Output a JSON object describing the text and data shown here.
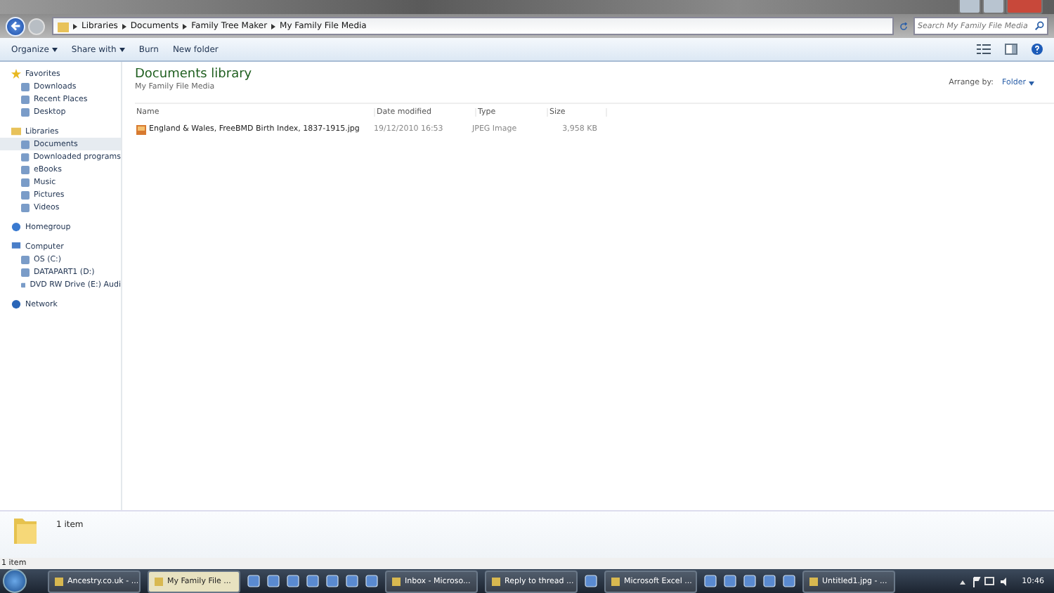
{
  "address_bar": {
    "crumbs": [
      "Libraries",
      "Documents",
      "Family Tree Maker",
      "My Family File Media"
    ]
  },
  "search": {
    "placeholder": "Search My Family File Media"
  },
  "toolbar": {
    "buttons": [
      {
        "label": "Organize",
        "dropdown": true
      },
      {
        "label": "Share with",
        "dropdown": true
      },
      {
        "label": "Burn",
        "dropdown": false
      },
      {
        "label": "New folder",
        "dropdown": false
      }
    ]
  },
  "sidebar": {
    "groups": [
      {
        "label": "Favorites",
        "kind": "star",
        "children": [
          {
            "label": "Downloads",
            "selected": false
          },
          {
            "label": "Recent Places",
            "selected": false
          },
          {
            "label": "Desktop",
            "selected": false
          }
        ]
      },
      {
        "label": "Libraries",
        "kind": "library",
        "children": [
          {
            "label": "Documents",
            "selected": true
          },
          {
            "label": "Downloaded programs",
            "selected": false
          },
          {
            "label": "eBooks",
            "selected": false
          },
          {
            "label": "Music",
            "selected": false
          },
          {
            "label": "Pictures",
            "selected": false
          },
          {
            "label": "Videos",
            "selected": false
          }
        ]
      },
      {
        "label": "Homegroup",
        "kind": "homegroup"
      },
      {
        "label": "Computer",
        "kind": "computer",
        "children": [
          {
            "label": "OS (C:)",
            "selected": false
          },
          {
            "label": "DATAPART1 (D:)",
            "selected": false
          },
          {
            "label": "DVD RW Drive (E:) Audi",
            "selected": false
          }
        ]
      },
      {
        "label": "Network",
        "kind": "network"
      }
    ]
  },
  "library": {
    "title": "Documents library",
    "subtitle": "My Family File Media",
    "arrange_label": "Arrange by:",
    "arrange_value": "Folder"
  },
  "table": {
    "columns": [
      "Name",
      "Date modified",
      "Type",
      "Size"
    ],
    "rows": [
      [
        "England & Wales, FreeBMD Birth Index, 1837-1915.jpg",
        "19/12/2010 16:53",
        "JPEG Image",
        "3,958 KB"
      ]
    ]
  },
  "details_pane": {
    "text": "1 item"
  },
  "status_bar": {
    "text": "1 item"
  },
  "taskbar": {
    "items": [
      {
        "kind": "button",
        "label": "Ancestry.co.uk - ...",
        "selected": false
      },
      {
        "kind": "button",
        "label": "My Family File ...",
        "selected": true
      },
      {
        "kind": "icon"
      },
      {
        "kind": "icon"
      },
      {
        "kind": "icon"
      },
      {
        "kind": "icon"
      },
      {
        "kind": "icon"
      },
      {
        "kind": "icon"
      },
      {
        "kind": "icon"
      },
      {
        "kind": "button",
        "label": "Inbox - Microso...",
        "selected": false
      },
      {
        "kind": "button",
        "label": "Reply to thread ...",
        "selected": false
      },
      {
        "kind": "icon"
      },
      {
        "kind": "button",
        "label": "Microsoft Excel ...",
        "selected": false
      },
      {
        "kind": "icon"
      },
      {
        "kind": "icon"
      },
      {
        "kind": "icon"
      },
      {
        "kind": "icon"
      },
      {
        "kind": "icon"
      },
      {
        "kind": "button",
        "label": "Untitled1.jpg - ...",
        "selected": false
      }
    ],
    "clock": "10:46"
  }
}
